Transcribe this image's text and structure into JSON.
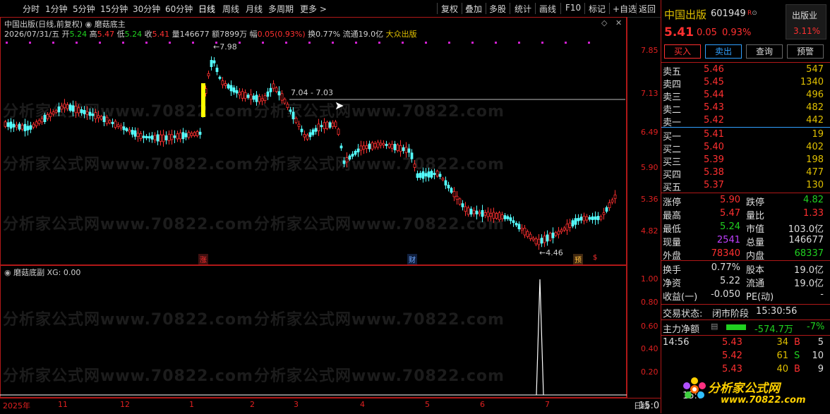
{
  "toolbar": {
    "tabs": [
      "分时",
      "1分钟",
      "5分钟",
      "15分钟",
      "30分钟",
      "60分钟",
      "日线",
      "周线",
      "月线",
      "多周期",
      "更多 >"
    ],
    "tools": [
      "复权",
      "叠加",
      "多股",
      "统计",
      "画线",
      "F10",
      "标记",
      "+自选",
      "返回"
    ]
  },
  "chart": {
    "title": "中国出版(日线,前复权)",
    "indicator_name": "磨菇底主",
    "date": "2026/07/31/五",
    "open_label": "开",
    "open": "5.24",
    "high_label": "高",
    "high": "5.47",
    "low_label": "低",
    "low": "5.24",
    "close_label": "收",
    "close": "5.41",
    "volume_label": "量",
    "volume": "146677",
    "amount_label": "额",
    "amount": "7899万",
    "change_label": "幅",
    "change": "0.05(0.93%)",
    "turnover_label": "换",
    "turnover": "0.77%",
    "float_label": "流通",
    "float": "19.0亿",
    "sector": "大众出版",
    "max_marker": "7.98",
    "min_marker": "4.46",
    "range_label": "7.04 - 7.03",
    "y_ticks": [
      "7.85",
      "7.13",
      "6.49",
      "5.90",
      "5.36",
      "4.82"
    ],
    "event_labels": [
      "涨",
      "财",
      "预",
      "$"
    ],
    "accent_red": "#e02020",
    "accent_cyan": "#00d8d8"
  },
  "sub": {
    "indicator_name": "磨菇底副",
    "xg_label": "XG: 0.00",
    "y_ticks": [
      "1.00",
      "0.80",
      "0.60",
      "0.40",
      "0.20"
    ]
  },
  "xaxis": {
    "labels": [
      "2025年",
      "11",
      "12",
      "1",
      "2",
      "3",
      "4",
      "5",
      "6",
      "7"
    ],
    "period_label": "日线"
  },
  "quote": {
    "name": "中国出版",
    "code": "601949",
    "tag": "R",
    "sector_name": "出版业",
    "sector_change": "3.11%",
    "price": "5.41",
    "change": "0.05",
    "change_pct": "0.93%",
    "buttons": [
      "买入",
      "卖出",
      "查询",
      "预警"
    ],
    "asks": [
      {
        "label": "卖五",
        "price": "5.46",
        "vol": "547"
      },
      {
        "label": "卖四",
        "price": "5.45",
        "vol": "1340"
      },
      {
        "label": "卖三",
        "price": "5.44",
        "vol": "496"
      },
      {
        "label": "卖二",
        "price": "5.43",
        "vol": "482"
      },
      {
        "label": "卖一",
        "price": "5.42",
        "vol": "442"
      }
    ],
    "bids": [
      {
        "label": "买一",
        "price": "5.41",
        "vol": "19"
      },
      {
        "label": "买二",
        "price": "5.40",
        "vol": "402"
      },
      {
        "label": "买三",
        "price": "5.39",
        "vol": "198"
      },
      {
        "label": "买四",
        "price": "5.38",
        "vol": "477"
      },
      {
        "label": "买五",
        "price": "5.37",
        "vol": "130"
      }
    ],
    "stats": [
      {
        "l1": "涨停",
        "v1": "5.90",
        "l2": "跌停",
        "v2": "4.82"
      },
      {
        "l1": "最高",
        "v1": "5.47",
        "l2": "量比",
        "v2": "1.33"
      },
      {
        "l1": "最低",
        "v1": "5.24",
        "l2": "市值",
        "v2": "103.0亿"
      },
      {
        "l1": "现量",
        "v1": "2541",
        "l2": "总量",
        "v2": "146677"
      },
      {
        "l1": "外盘",
        "v1": "78340",
        "l2": "内盘",
        "v2": "68337"
      }
    ],
    "stats2": [
      {
        "l1": "换手",
        "v1": "0.77%",
        "l2": "股本",
        "v2": "19.0亿"
      },
      {
        "l1": "净资",
        "v1": "5.22",
        "l2": "流通",
        "v2": "19.0亿"
      },
      {
        "l1": "收益(一)",
        "v1": "-0.050",
        "l2": "PE(动)",
        "v2": "-"
      }
    ],
    "trade_status_label": "交易状态:",
    "trade_status": "闭市阶段",
    "trade_time": "15:30:56",
    "main_flow_label": "主力净额",
    "main_flow": "-574.7万",
    "main_flow_pct": "-7%",
    "ticks": [
      {
        "time": "14:56",
        "price": "5.43",
        "vol": "34",
        "side": "B",
        "n": "5"
      },
      {
        "time": "",
        "price": "5.42",
        "vol": "61",
        "side": "S",
        "n": "10"
      },
      {
        "time": "",
        "price": "5.43",
        "vol": "40",
        "side": "B",
        "n": "9"
      }
    ],
    "bottom_time": "15:0",
    "logo_text": "分析家公式网",
    "logo_url": "www.70822.com"
  },
  "watermark": {
    "text": "分析家公式网www.70822.com"
  }
}
